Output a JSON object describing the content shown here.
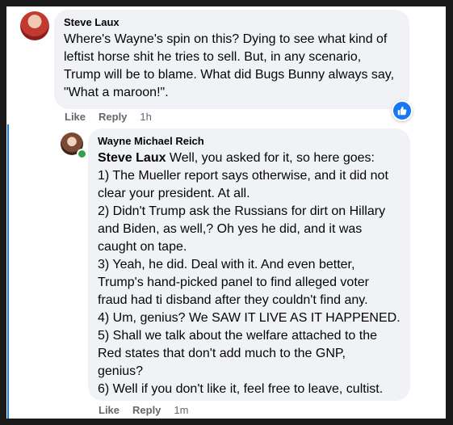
{
  "comments": [
    {
      "author": "Steve Laux",
      "text": "Where's Wayne's spin on this? Dying to see what kind of\nleftist horse shit he tries to sell. But, in any scenario,\nTrump will be to blame. What did Bugs Bunny always say,\n\"What a maroon!\".",
      "actions": {
        "like": "Like",
        "reply": "Reply",
        "time": "1h"
      },
      "reaction_icon": "thumbs-up-icon"
    },
    {
      "author": "Wayne Michael Reich",
      "mention": "Steve Laux",
      "text": " Well, you asked for it, so here goes:\n1) The Mueller report says otherwise, and it did not\nclear your president. At all.\n2) Didn't Trump ask the Russians for dirt on Hillary\nand Biden, as well,? Oh yes he did, and it was\ncaught on tape.\n3) Yeah, he did. Deal with it. And even better,\nTrump's hand-picked panel to find alleged voter\nfraud had ti disband after they couldn't find any.\n4) Um, genius? We SAW IT LIVE AS IT HAPPENED.\n5) Shall we talk about the welfare attached to the\nRed states that don't add much to the GNP,\ngenius?\n6) Well if you don't like it, feel free to leave, cultist.",
      "actions": {
        "like": "Like",
        "reply": "Reply",
        "time": "1m"
      },
      "online": true
    }
  ],
  "colors": {
    "accent": "#1877f2",
    "bubble": "#f0f2f5",
    "meta": "#65676b",
    "online": "#31a24c"
  }
}
